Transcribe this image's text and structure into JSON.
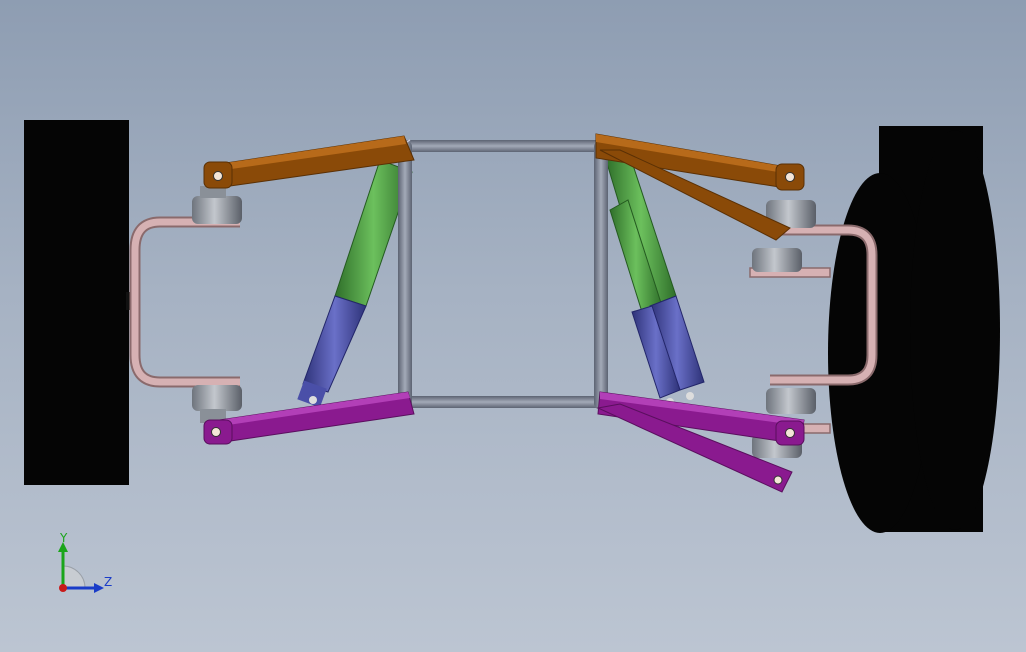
{
  "viewport": {
    "background_top": "#8e9db2",
    "background_bottom": "#bcc5d2"
  },
  "model": {
    "parts": [
      {
        "name": "left-wheel",
        "color": "#050505"
      },
      {
        "name": "right-wheel",
        "color": "#050505"
      },
      {
        "name": "chassis-frame",
        "color": "#7d8595"
      },
      {
        "name": "upper-control-arm",
        "color": "#8a4a08"
      },
      {
        "name": "lower-control-arm",
        "color": "#8a1a8f"
      },
      {
        "name": "shock-spring",
        "color": "#4f9a43"
      },
      {
        "name": "shock-damper",
        "color": "#4a4fa8"
      },
      {
        "name": "upright-knuckle",
        "color": "#c4a0a2"
      },
      {
        "name": "ball-joint",
        "color": "#9aa0a8"
      }
    ]
  },
  "triad": {
    "y_label": "Y",
    "z_label": "Z",
    "y_color": "#1aa51a",
    "z_color": "#1a3cc8",
    "x_color": "#c81a1a"
  }
}
